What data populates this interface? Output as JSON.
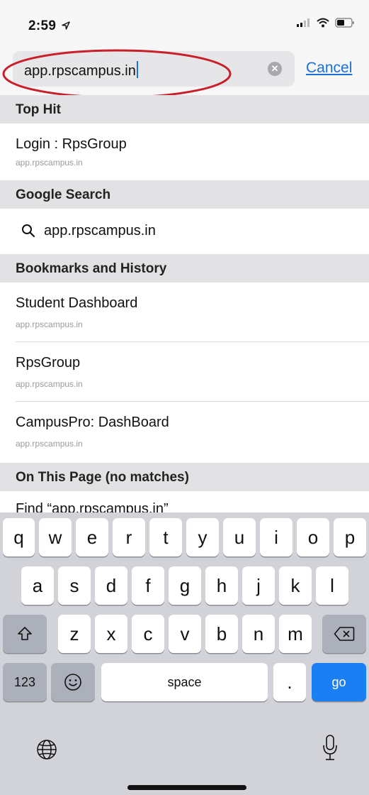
{
  "status_bar": {
    "time": "2:59"
  },
  "search": {
    "query": "app.rpscampus.in",
    "cancel_label": "Cancel"
  },
  "sections": {
    "top_hit": {
      "header": "Top Hit",
      "items": [
        {
          "title": "Login : RpsGroup",
          "url": "app.rpscampus.in"
        }
      ]
    },
    "google_search": {
      "header": "Google Search",
      "query": "app.rpscampus.in"
    },
    "bookmarks_history": {
      "header": "Bookmarks and History",
      "items": [
        {
          "title": "Student Dashboard",
          "url": "app.rpscampus.in"
        },
        {
          "title": "RpsGroup",
          "url": "app.rpscampus.in"
        },
        {
          "title": "CampusPro: DashBoard",
          "url": "app.rpscampus.in"
        }
      ]
    },
    "on_this_page": {
      "header": "On This Page (no matches)",
      "find_label": "Find “app.rpscampus.in”"
    }
  },
  "keyboard": {
    "row1": [
      "q",
      "w",
      "e",
      "r",
      "t",
      "y",
      "u",
      "i",
      "o",
      "p"
    ],
    "row2": [
      "a",
      "s",
      "d",
      "f",
      "g",
      "h",
      "j",
      "k",
      "l"
    ],
    "row3": [
      "z",
      "x",
      "c",
      "v",
      "b",
      "n",
      "m"
    ],
    "numbers_label": "123",
    "space_label": "space",
    "period_label": ".",
    "go_label": "go"
  },
  "colors": {
    "accent": "#1a6fd8",
    "annotation": "#c8202a",
    "go_key": "#1a7ff2"
  }
}
